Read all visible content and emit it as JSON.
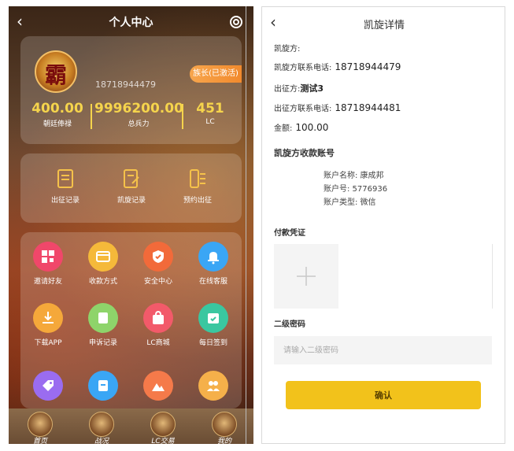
{
  "left": {
    "title": "个人中心",
    "icons": {
      "back": "chevron-left-icon",
      "settings": "gear-icon"
    },
    "profile": {
      "avatar_text": "霸",
      "phone": "18718944479",
      "badge": "族长(已激活)",
      "stats": [
        {
          "value": "400.00",
          "label": "朝廷俸禄"
        },
        {
          "value": "9996200.00",
          "label": "总兵力"
        },
        {
          "value": "451",
          "label": "LC"
        }
      ]
    },
    "records": [
      {
        "label": "出征记录",
        "icon": "document-icon"
      },
      {
        "label": "凯旋记录",
        "icon": "edit-document-icon"
      },
      {
        "label": "预约出征",
        "icon": "list-icon"
      }
    ],
    "grid": [
      {
        "label": "邀请好友",
        "icon": "qrcode-icon",
        "color": "#f0476a"
      },
      {
        "label": "收款方式",
        "icon": "card-icon",
        "color": "#f5b93a"
      },
      {
        "label": "安全中心",
        "icon": "shield-icon",
        "color": "#f26a3a"
      },
      {
        "label": "在线客服",
        "icon": "bell-icon",
        "color": "#3aa6f5"
      },
      {
        "label": "下载APP",
        "icon": "download-icon",
        "color": "#f5a83a"
      },
      {
        "label": "申诉记录",
        "icon": "record-icon",
        "color": "#8ed46a"
      },
      {
        "label": "LC商城",
        "icon": "bag-icon",
        "color": "#f25a6a"
      },
      {
        "label": "每日签到",
        "icon": "calendar-check-icon",
        "color": "#3ac7a0"
      },
      {
        "label": "",
        "icon": "tag-icon",
        "color": "#9a6cf0"
      },
      {
        "label": "",
        "icon": "save-icon",
        "color": "#3aa6f5"
      },
      {
        "label": "",
        "icon": "mountain-icon",
        "color": "#f57a4a"
      },
      {
        "label": "",
        "icon": "users-icon",
        "color": "#f5b04a"
      }
    ],
    "nav": [
      {
        "label": "首页"
      },
      {
        "label": "战况"
      },
      {
        "label": "LC交易"
      },
      {
        "label": "我的"
      }
    ]
  },
  "right": {
    "title": "凯旋详情",
    "icons": {
      "back": "chevron-left-icon",
      "upload": "plus-icon"
    },
    "fields": {
      "kaixuan_label": "凯旋方:",
      "kaixuan_value": "",
      "kaixuan_phone_label": "凯旋方联系电话:",
      "kaixuan_phone": "18718944479",
      "chuzheng_label": "出征方:",
      "chuzheng_value": "测试3",
      "chuzheng_phone_label": "出征方联系电话:",
      "chuzheng_phone": "18718944481",
      "amount_label": "金额:",
      "amount_value": "100.00"
    },
    "account_section": "凯旋方收款账号",
    "account": {
      "name_line": "账户名称: 康成邦",
      "number_line": "账户号: 5776936",
      "type_line": "账户类型: 微信"
    },
    "payment_proof": "付款凭证",
    "secondary_pwd": "二级密码",
    "pwd_placeholder": "请输入二级密码",
    "confirm": "确认"
  }
}
